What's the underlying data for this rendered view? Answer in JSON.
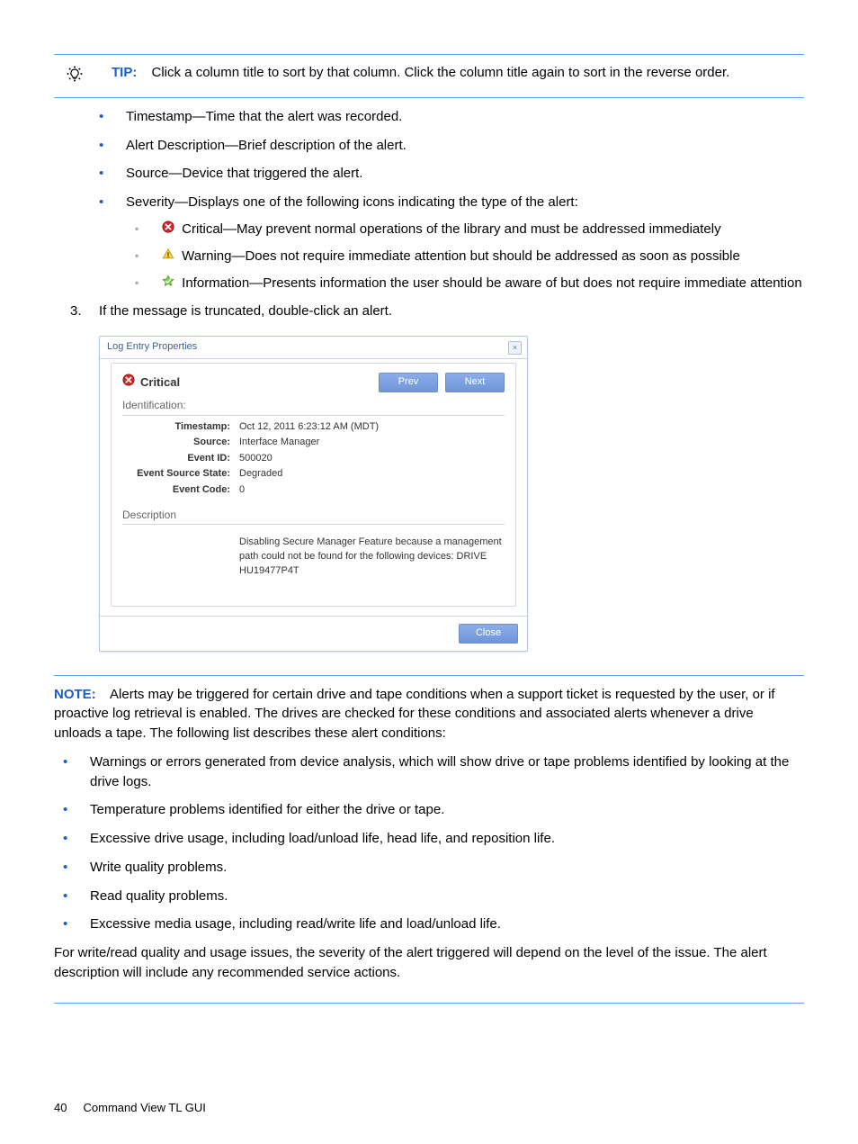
{
  "tip": {
    "label": "TIP:",
    "text": "Click a column title to sort by that column. Click the column title again to sort in the reverse order."
  },
  "column_bullets": [
    "Timestamp—Time that the alert was recorded.",
    "Alert Description—Brief description of the alert.",
    "Source—Device that triggered the alert.",
    "Severity—Displays one of the following icons indicating the type of the alert:"
  ],
  "severity_items": [
    "Critical—May prevent normal operations of the library and must be addressed immediately",
    "Warning—Does not require immediate attention but should be addressed as soon as possible",
    "Information—Presents information the user should be aware of but does not require immediate attention"
  ],
  "step3": {
    "num": "3.",
    "text": "If the message is truncated, double-click an alert."
  },
  "dialog": {
    "title": "Log Entry Properties",
    "close_x": "×",
    "severity_label": "Critical",
    "nav": {
      "prev": "Prev",
      "next": "Next"
    },
    "section_identification": "Identification:",
    "fields": {
      "timestamp_k": "Timestamp:",
      "timestamp_v": "Oct 12, 2011 6:23:12 AM (MDT)",
      "source_k": "Source:",
      "source_v": "Interface Manager",
      "event_id_k": "Event ID:",
      "event_id_v": "500020",
      "ess_k": "Event Source State:",
      "ess_v": "Degraded",
      "ec_k": "Event Code:",
      "ec_v": "0"
    },
    "section_description": "Description",
    "description_text": "Disabling Secure Manager Feature because a management path could not be found for the following devices: DRIVE HU19477P4T",
    "close_btn": "Close"
  },
  "note": {
    "label": "NOTE:",
    "intro": "Alerts may be triggered for certain drive and tape conditions when a support ticket is requested by the user, or if proactive log retrieval is enabled. The drives are checked for these conditions and associated alerts whenever a drive unloads a tape. The following list describes these alert conditions:",
    "bullets": [
      "Warnings or errors generated from device analysis, which will show drive or tape problems identified by looking at the drive logs.",
      "Temperature problems identified for either the drive or tape.",
      "Excessive drive usage, including load/unload life, head life, and reposition life.",
      "Write quality problems.",
      "Read quality problems.",
      "Excessive media usage, including read/write life and load/unload life."
    ],
    "outro": "For write/read quality and usage issues, the severity of the alert triggered will depend on the level of the issue. The alert description will include any recommended service actions."
  },
  "footer": {
    "page_num": "40",
    "chapter": "Command View TL GUI"
  }
}
